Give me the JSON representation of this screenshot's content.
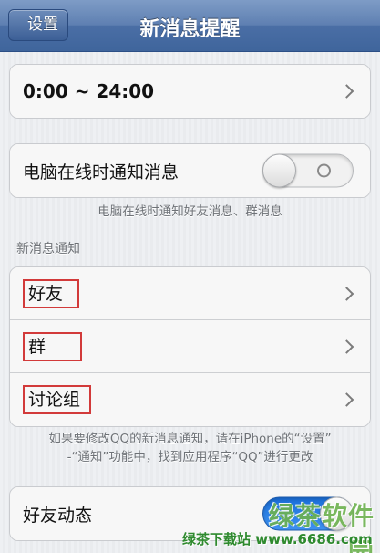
{
  "nav": {
    "back_label": "设置",
    "title": "新消息提醒"
  },
  "time_range": {
    "value": "0:00 ~ 24:00"
  },
  "pc_online": {
    "label": "电脑在线时通知消息",
    "toggle_on": false,
    "note": "电脑在线时通知好友消息、群消息"
  },
  "section": {
    "label": "新消息通知"
  },
  "notify_items": [
    {
      "label": "好友"
    },
    {
      "label": "群"
    },
    {
      "label": "讨论组"
    }
  ],
  "notify_note_lines": [
    "如果要修改QQ的新消息通知，请在iPhone的“设置”",
    "-“通知”功能中，找到应用程序“QQ”进行更改"
  ],
  "friend_feed": {
    "label": "好友动态",
    "toggle_on": true
  },
  "watermark": {
    "logo_text": "绿茶软件园",
    "bottom_text": "绿茶下载站 www.6686.com"
  },
  "colors": {
    "nav_blue": "#4a6ea5",
    "highlight_red": "#d23a3a",
    "toggle_blue": "#1b6fd9"
  }
}
